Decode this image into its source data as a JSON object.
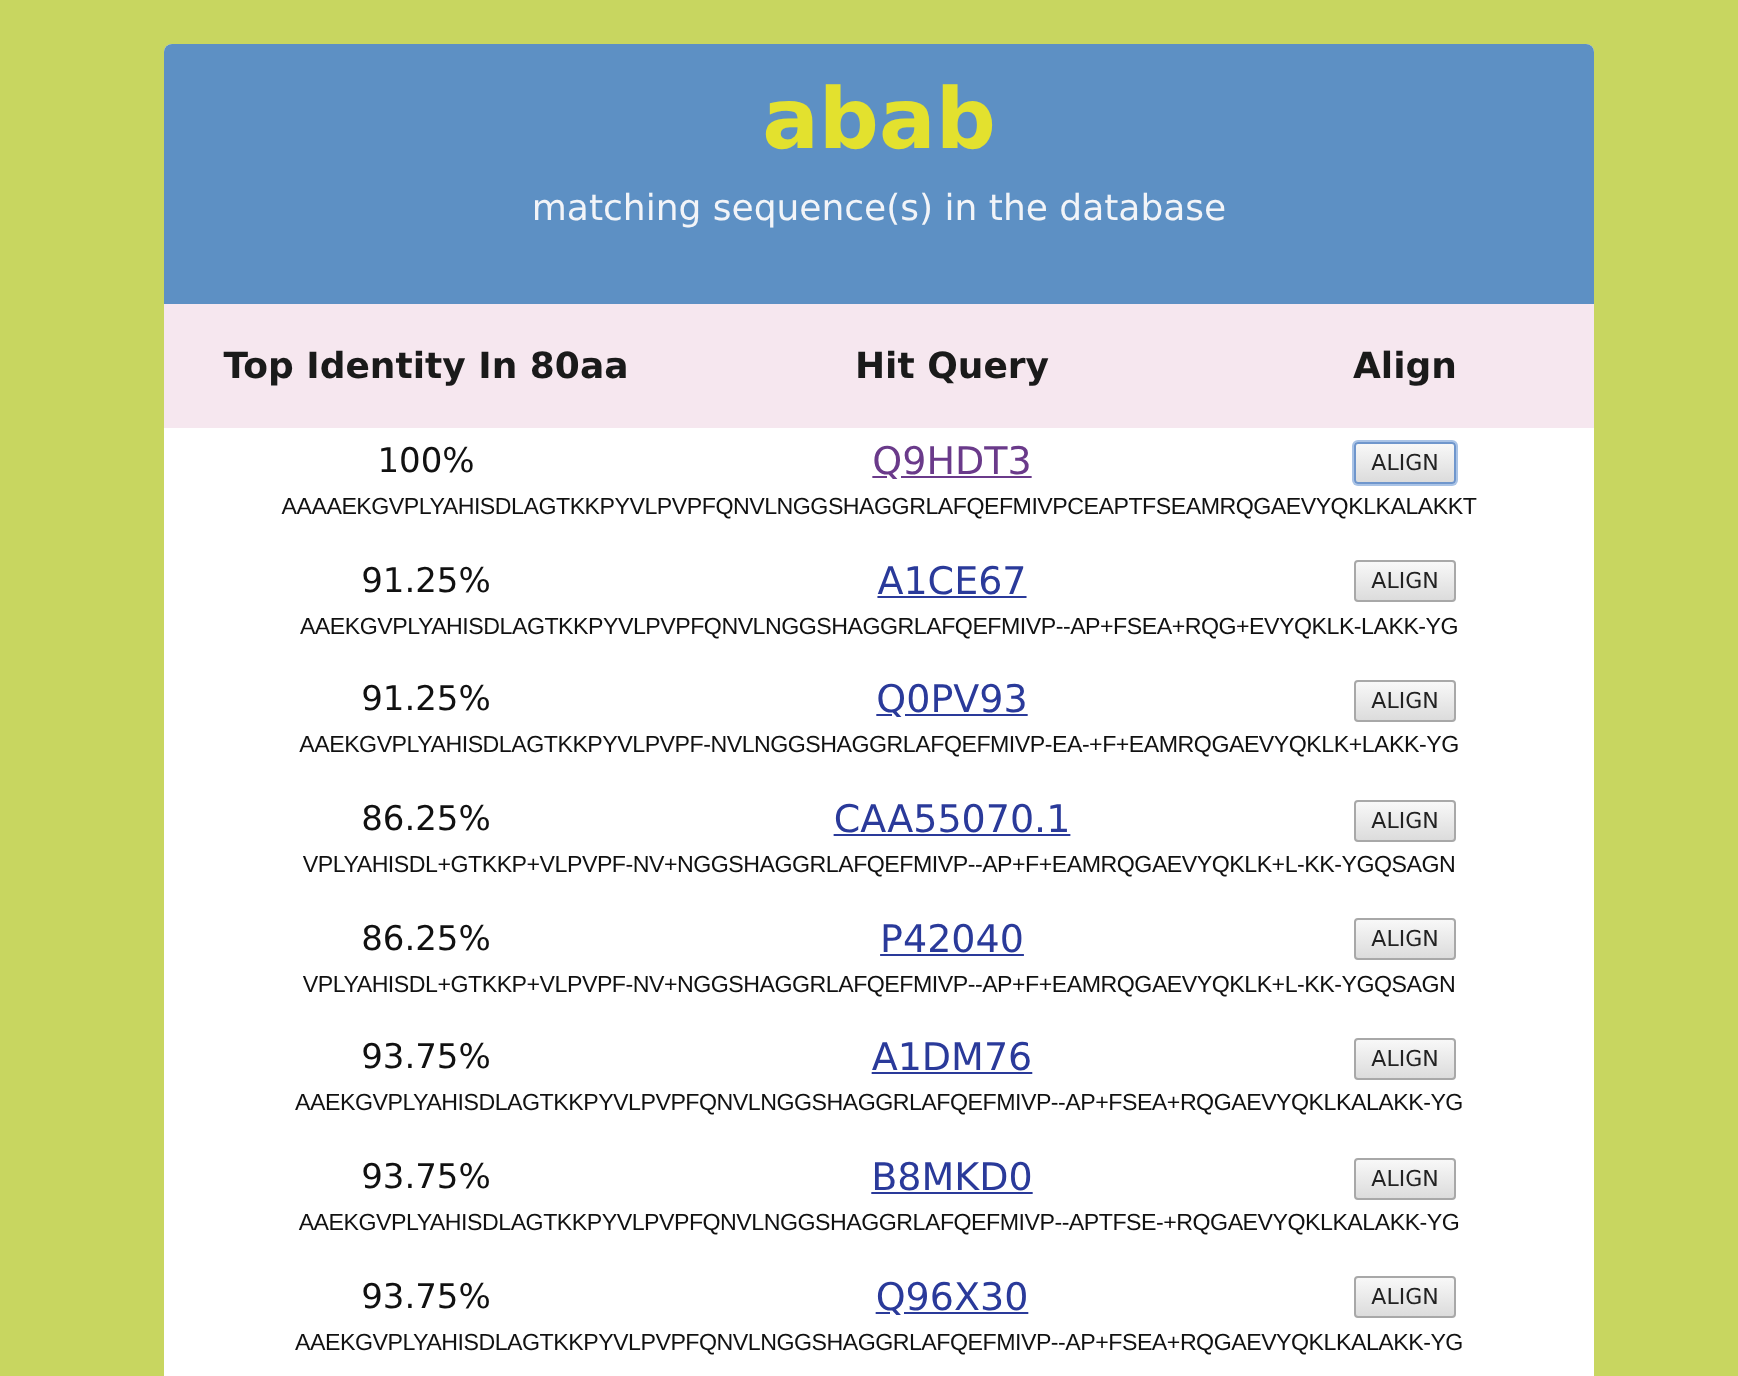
{
  "header": {
    "title": "abab",
    "subtitle": "matching sequence(s) in the database"
  },
  "columns": [
    "Top Identity In 80aa",
    "Hit Query",
    "Align"
  ],
  "rows": [
    {
      "identity": "100%",
      "hit": "Q9HDT3",
      "visited": true,
      "button": "ALIGN",
      "focused": true,
      "sequence": "AAAAEKGVPLYAHISDLAGTKKPYVLPVPFQNVLNGGSHAGGRLAFQEFMIVPCEAPTFSEAMRQGAEVYQKLKALAKKT"
    },
    {
      "identity": "91.25%",
      "hit": "A1CE67",
      "visited": false,
      "button": "ALIGN",
      "focused": false,
      "sequence": "AAEKGVPLYAHISDLAGTKKPYVLPVPFQNVLNGGSHAGGRLAFQEFMIVP--AP+FSEA+RQG+EVYQKLK-LAKK-YG"
    },
    {
      "identity": "91.25%",
      "hit": "Q0PV93",
      "visited": false,
      "button": "ALIGN",
      "focused": false,
      "sequence": "AAEKGVPLYAHISDLAGTKKPYVLPVPF-NVLNGGSHAGGRLAFQEFMIVP-EA-+F+EAMRQGAEVYQKLK+LAKK-YG"
    },
    {
      "identity": "86.25%",
      "hit": "CAA55070.1",
      "visited": false,
      "button": "ALIGN",
      "focused": false,
      "sequence": "VPLYAHISDL+GTKKP+VLPVPF-NV+NGGSHAGGRLAFQEFMIVP--AP+F+EAMRQGAEVYQKLK+L-KK-YGQSAGN"
    },
    {
      "identity": "86.25%",
      "hit": "P42040",
      "visited": false,
      "button": "ALIGN",
      "focused": false,
      "sequence": "VPLYAHISDL+GTKKP+VLPVPF-NV+NGGSHAGGRLAFQEFMIVP--AP+F+EAMRQGAEVYQKLK+L-KK-YGQSAGN"
    },
    {
      "identity": "93.75%",
      "hit": "A1DM76",
      "visited": false,
      "button": "ALIGN",
      "focused": false,
      "sequence": "AAEKGVPLYAHISDLAGTKKPYVLPVPFQNVLNGGSHAGGRLAFQEFMIVP--AP+FSEA+RQGAEVYQKLKALAKK-YG"
    },
    {
      "identity": "93.75%",
      "hit": "B8MKD0",
      "visited": false,
      "button": "ALIGN",
      "focused": false,
      "sequence": "AAEKGVPLYAHISDLAGTKKPYVLPVPFQNVLNGGSHAGGRLAFQEFMIVP--APTFSE-+RQGAEVYQKLKALAKK-YG"
    },
    {
      "identity": "93.75%",
      "hit": "Q96X30",
      "visited": false,
      "button": "ALIGN",
      "focused": false,
      "sequence": "AAEKGVPLYAHISDLAGTKKPYVLPVPFQNVLNGGSHAGGRLAFQEFMIVP--AP+FSEA+RQGAEVYQKLKALAKK-YG"
    }
  ]
}
